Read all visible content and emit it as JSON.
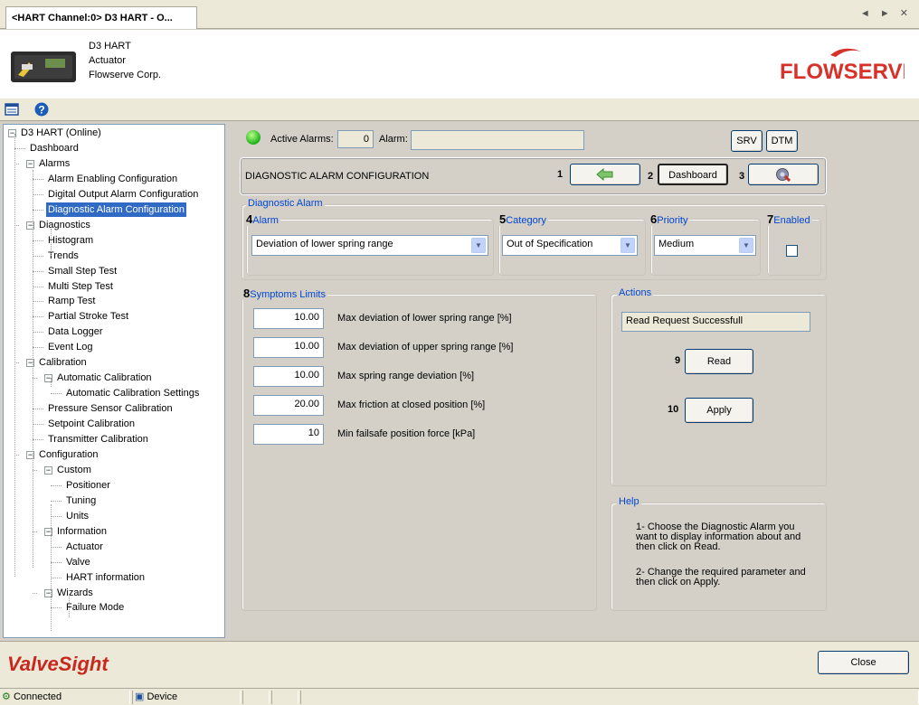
{
  "tab": {
    "title": "<HART Channel:0> D3 HART - O...",
    "nav": "◄ ► ✕"
  },
  "device": {
    "line1": "D3 HART",
    "line2": "Actuator",
    "line3": "Flowserve Corp."
  },
  "logo_text": "FLOWSERVE",
  "tree": [
    {
      "label": "D3 HART (Online)",
      "level": 0,
      "expander": "−"
    },
    {
      "label": "Dashboard",
      "level": 1
    },
    {
      "label": "Alarms",
      "level": 1,
      "expander": "−"
    },
    {
      "label": "Alarm Enabling Configuration",
      "level": 2
    },
    {
      "label": "Digital Output Alarm Configuration",
      "level": 2
    },
    {
      "label": "Diagnostic Alarm Configuration",
      "level": 2,
      "selected": true
    },
    {
      "label": "Diagnostics",
      "level": 1,
      "expander": "−"
    },
    {
      "label": "Histogram",
      "level": 2
    },
    {
      "label": "Trends",
      "level": 2
    },
    {
      "label": "Small Step Test",
      "level": 2
    },
    {
      "label": "Multi Step Test",
      "level": 2
    },
    {
      "label": "Ramp Test",
      "level": 2
    },
    {
      "label": "Partial Stroke Test",
      "level": 2
    },
    {
      "label": "Data Logger",
      "level": 2
    },
    {
      "label": "Event Log",
      "level": 2
    },
    {
      "label": "Calibration",
      "level": 1,
      "expander": "−"
    },
    {
      "label": "Automatic Calibration",
      "level": 2,
      "expander": "−"
    },
    {
      "label": "Automatic Calibration Settings",
      "level": 3
    },
    {
      "label": "Pressure Sensor Calibration",
      "level": 2
    },
    {
      "label": "Setpoint Calibration",
      "level": 2
    },
    {
      "label": "Transmitter Calibration",
      "level": 2
    },
    {
      "label": "Configuration",
      "level": 1,
      "expander": "−"
    },
    {
      "label": "Custom",
      "level": 2,
      "expander": "−"
    },
    {
      "label": "Positioner",
      "level": 3
    },
    {
      "label": "Tuning",
      "level": 3
    },
    {
      "label": "Units",
      "level": 3
    },
    {
      "label": "Information",
      "level": 2,
      "expander": "−"
    },
    {
      "label": "Actuator",
      "level": 3
    },
    {
      "label": "Valve",
      "level": 3
    },
    {
      "label": "HART information",
      "level": 3
    },
    {
      "label": "Wizards",
      "level": 2,
      "expander": "−"
    },
    {
      "label": "Failure Mode",
      "level": 3
    }
  ],
  "alarms_bar": {
    "active_label": "Active Alarms:",
    "active_count": "0",
    "alarm_label": "Alarm:",
    "alarm_value": "",
    "srv": "SRV",
    "dtm": "DTM"
  },
  "title_bar": {
    "title": "DIAGNOSTIC ALARM CONFIGURATION",
    "n1": "1",
    "n2": "2",
    "dashboard": "Dashboard",
    "n3": "3"
  },
  "diag": {
    "group": "Diagnostic Alarm",
    "n4": "4",
    "alarm_label": "Alarm",
    "alarm_value": "Deviation of lower spring range",
    "n5": "5",
    "category_label": "Category",
    "category_value": "Out of Specification",
    "n6": "6",
    "priority_label": "Priority",
    "priority_value": "Medium",
    "n7": "7",
    "enabled_label": "Enabled"
  },
  "symptoms": {
    "n8": "8",
    "group": "Symptoms Limits",
    "rows": [
      {
        "value": "10.00",
        "label": "Max deviation of lower spring range [%]"
      },
      {
        "value": "10.00",
        "label": "Max deviation of upper spring range [%]"
      },
      {
        "value": "10.00",
        "label": "Max spring range deviation [%]"
      },
      {
        "value": "20.00",
        "label": "Max friction at closed position [%]"
      },
      {
        "value": "10",
        "label": "Min failsafe position force [kPa]"
      }
    ]
  },
  "actions": {
    "group": "Actions",
    "status": "Read Request Successfull",
    "n9": "9",
    "read": "Read",
    "n10": "10",
    "apply": "Apply"
  },
  "help": {
    "group": "Help",
    "p1": "1- Choose the Diagnostic Alarm you want to display information about and then click on Read.",
    "p2": "2- Change the required parameter and then click on Apply."
  },
  "footer": {
    "brand": "ValveSight",
    "close": "Close"
  },
  "status": {
    "connected": "Connected",
    "device": "Device"
  }
}
